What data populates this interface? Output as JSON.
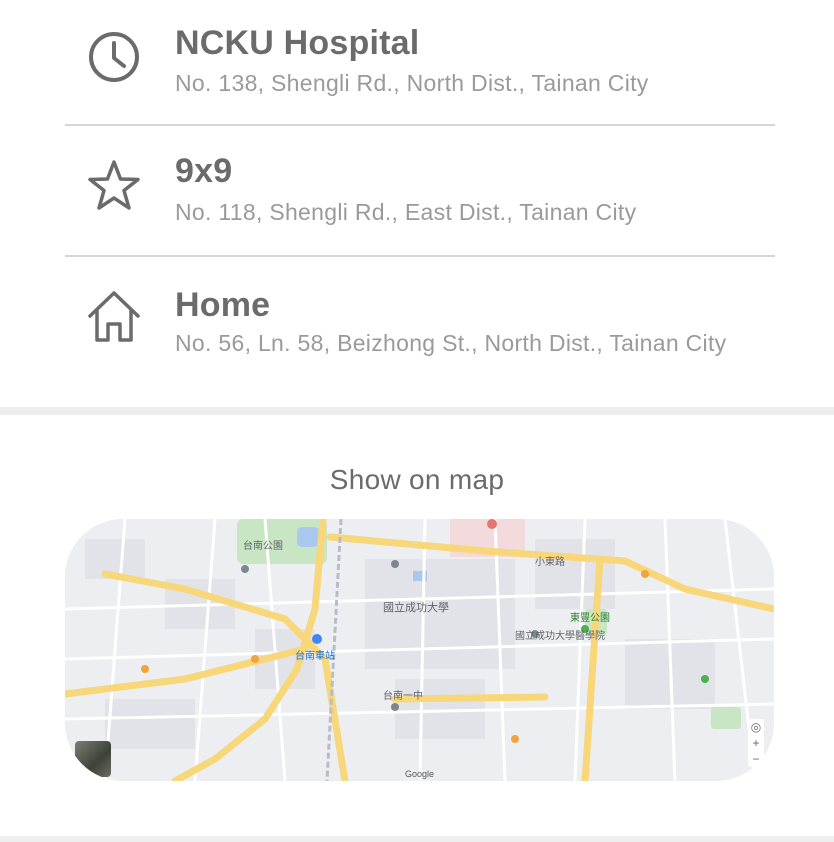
{
  "places": [
    {
      "title": "NCKU Hospital",
      "address": "No. 138, Shengli Rd., North Dist., Tainan City",
      "icon": "clock-icon"
    },
    {
      "title": "9x9",
      "address": "No. 118, Shengli Rd., East Dist., Tainan City",
      "icon": "star-icon"
    },
    {
      "title": "Home",
      "address": "No. 56, Ln. 58, Beizhong St., North Dist., Tainan City",
      "icon": "home-icon"
    }
  ],
  "map_section": {
    "heading": "Show on map",
    "labels": {
      "ncku": "國立成功大學",
      "station": "台南車站",
      "hospital": "國立成功大學醫學院",
      "park": "台南公園",
      "school": "台南一中",
      "xiaodong": "小東路",
      "dongfeng": "東豐公園",
      "google": "Google"
    }
  },
  "colors": {
    "title": "#6b6b6b",
    "address": "#9a9a9a",
    "divider": "#d6d6d6",
    "icon": "#6b6b6b",
    "map_road_major": "#f7d77a",
    "map_park": "#c8e6c4"
  }
}
